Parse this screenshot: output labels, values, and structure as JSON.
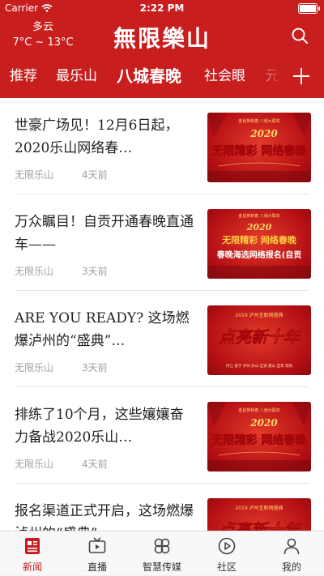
{
  "status_bar": {
    "carrier": "Carrier",
    "time": "2:22 PM"
  },
  "weather": {
    "condition": "多云",
    "temperature": "7°C ~ 13°C"
  },
  "brand": {
    "logo_text": "無限樂山",
    "primary_color": "#c81e1e"
  },
  "channels": [
    "推荐",
    "最乐山",
    "八城春晚",
    "社会眼",
    "元"
  ],
  "active_channel": "八城春晚",
  "articles": [
    {
      "title": "世豪广场见！12月6日起，2020乐山网络春…",
      "source": "无限乐山",
      "time": "4天前",
      "thumb": {
        "top_text": "金鼠贺新春 八城大联欢",
        "big_text": "2020",
        "main_text": "无限精彩 网络春晚",
        "sub_text": ""
      }
    },
    {
      "title": "万众瞩目！自贡开通春晚直通车——",
      "source": "无限乐山",
      "time": "3天前",
      "thumb": {
        "top_text": "金鼠贺新春 八城大联欢",
        "big_text": "2020",
        "main_text": "无限精彩 网络春晚",
        "sub_text": "春晚海选网络报名(自贡"
      }
    },
    {
      "title": "ARE YOU READY? 这场燃爆泸州的“盛典”…",
      "source": "无限乐山",
      "time": "3天前",
      "thumb": {
        "top_text": "2019 泸州互联网盛典",
        "big_text": "",
        "main_text": "点亮新十年",
        "sub_text": "内江 遂宁 泸州 乐山 自贡 眉山 宜宾 资阳"
      }
    },
    {
      "title": "排练了10个月，这些孃孃奋力备战2020乐山…",
      "source": "无限乐山",
      "time": "4天前",
      "thumb": {
        "top_text": "金鼠贺新春 八城大联欢",
        "big_text": "2020",
        "main_text": "无限精彩 网络春晚",
        "sub_text": ""
      }
    },
    {
      "title": "报名渠道正式开启，这场燃爆泸州的“盛典”…",
      "source": "",
      "time": "",
      "thumb": {
        "top_text": "2019 泸州互联网盛典",
        "big_text": "",
        "main_text": "点亮新十年",
        "sub_text": ""
      }
    }
  ],
  "tabbar": [
    {
      "label": "新闻",
      "icon": "news-icon",
      "active": true
    },
    {
      "label": "直播",
      "icon": "tv-icon",
      "active": false
    },
    {
      "label": "智慧传媒",
      "icon": "clover-icon",
      "active": false
    },
    {
      "label": "社区",
      "icon": "play-circle-icon",
      "active": false
    },
    {
      "label": "我的",
      "icon": "person-icon",
      "active": false
    }
  ]
}
